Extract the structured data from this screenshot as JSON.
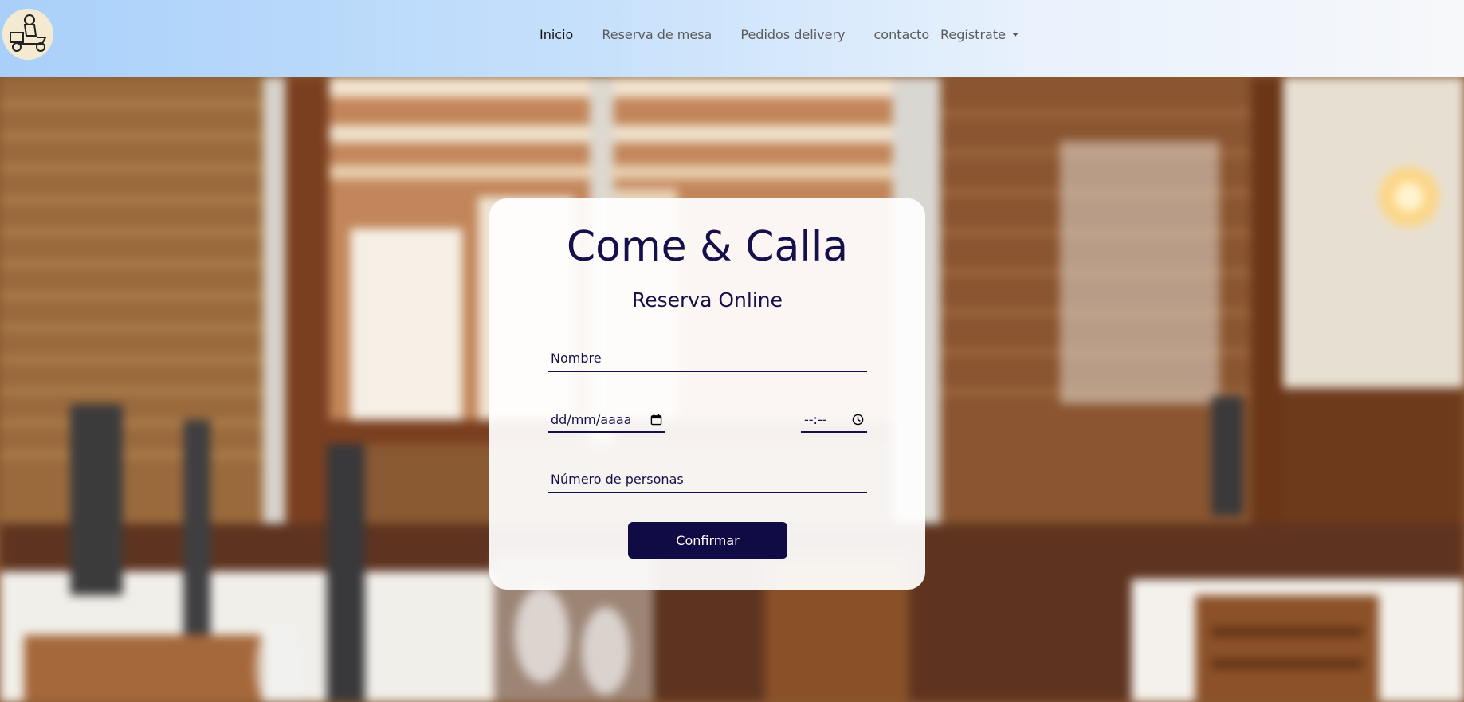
{
  "navbar": {
    "logo": "delivery-scooter-logo",
    "links": [
      "Inicio",
      "Reserva de mesa",
      "Pedidos delivery",
      "contacto"
    ],
    "active_link": "Inicio",
    "dropdown_label": "Regístrate"
  },
  "form": {
    "title": "Come & Calla",
    "subtitle": "Reserva Online",
    "name_placeholder": "Nombre",
    "date_placeholder": "dd/mm/aaaa",
    "time_placeholder": "--:--",
    "people_placeholder": "Número de personas",
    "submit_label": "Confirmar"
  },
  "colors": {
    "primary": "#100a45",
    "navbar_start": "#a9d0fa",
    "navbar_end": "#f7f8fa"
  }
}
